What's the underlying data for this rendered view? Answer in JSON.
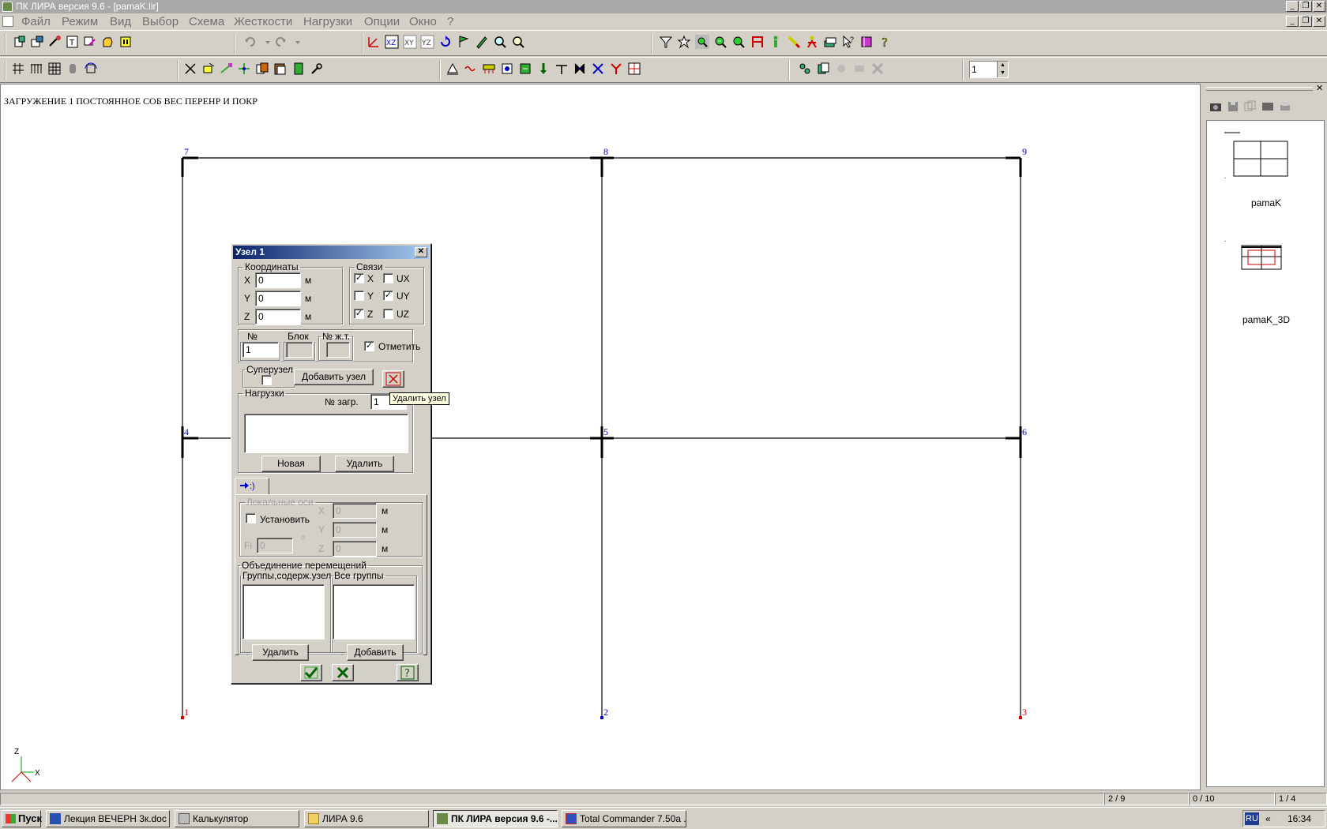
{
  "app": {
    "title": "ПК ЛИРА  версия 9.6 - [pamaK.lir]"
  },
  "menu": [
    "Файл",
    "Режим",
    "Вид",
    "Выбор",
    "Схема",
    "Жесткости",
    "Нагрузки",
    "Опции",
    "Окно",
    "?"
  ],
  "toolbar": {
    "load_number": "1"
  },
  "canvas": {
    "caption": "ЗАГРУЖЕНИЕ 1 ПОСТОЯННОЕ СОБ ВЕС ПЕРЕНР И ПОКР",
    "node_labels": [
      "1",
      "2",
      "3",
      "4",
      "5",
      "6",
      "7",
      "8",
      "9"
    ],
    "axis_z": "Z",
    "axis_x": "X"
  },
  "right_panel": {
    "views": [
      {
        "label": "pamaK"
      },
      {
        "label": "pamaK_3D"
      }
    ]
  },
  "dialog": {
    "title": "Узел 1",
    "coords": {
      "legend": "Координаты",
      "x_label": "X",
      "x_value": "0",
      "y_label": "Y",
      "y_value": "0",
      "z_label": "Z",
      "z_value": "0",
      "unit": "м"
    },
    "links": {
      "legend": "Связи",
      "items": [
        {
          "label": "X",
          "checked": true
        },
        {
          "label": "UX",
          "checked": false
        },
        {
          "label": "Y",
          "checked": false
        },
        {
          "label": "UY",
          "checked": true
        },
        {
          "label": "Z",
          "checked": true
        },
        {
          "label": "UZ",
          "checked": false
        }
      ]
    },
    "node_no": {
      "legend": "№ узла",
      "value": "1"
    },
    "block": {
      "legend": "Блок N",
      "value": ""
    },
    "stiffness": {
      "legend": "№ ж.т.",
      "value": ""
    },
    "mark": {
      "label": "Отметить",
      "checked": true
    },
    "supernode": {
      "legend": "Суперузел",
      "checked": false
    },
    "add_node": "Добавить узел",
    "delete_node_tooltip": "Удалить узел",
    "loads": {
      "legend": "Нагрузки",
      "load_no_label": "№ загр.",
      "load_no_value": "1",
      "new_button": "Новая",
      "delete_button": "Удалить"
    },
    "local_axes": {
      "legend": "Локальные оси",
      "set_label": "Установить",
      "set_checked": false,
      "x_label": "X",
      "x_value": "0",
      "y_label": "Y",
      "y_value": "0",
      "z_label": "Z",
      "z_value": "0",
      "fi_label": "Fi",
      "fi_value": "0",
      "deg": "о",
      "unit": "м"
    },
    "displacement": {
      "legend": "Объединение перемещений",
      "groups_with_node": "Группы,содерж.узел",
      "all_groups": "Все группы",
      "delete_button": "Удалить",
      "add_button": "Добавить"
    }
  },
  "status": {
    "cell1": "2 / 9",
    "cell2": "0 / 10",
    "cell3": "1 / 4"
  },
  "taskbar": {
    "start": "Пуск",
    "tasks": [
      {
        "label": "Лекция ВЕЧЕРН 3к.doc ...",
        "active": false
      },
      {
        "label": "Калькулятор",
        "active": false
      },
      {
        "label": "ЛИРА 9.6",
        "active": false
      },
      {
        "label": "ПК ЛИРА  версия 9.6 -...",
        "active": true
      },
      {
        "label": "Total Commander 7.50a ...",
        "active": false
      }
    ],
    "lang": "RU",
    "time": "16:34",
    "chevron": "«"
  },
  "colors": {
    "node_blue": "#0000cc",
    "node_red": "#cc0000",
    "title_grad_start": "#0a246a",
    "title_grad_end": "#a6caf0"
  }
}
